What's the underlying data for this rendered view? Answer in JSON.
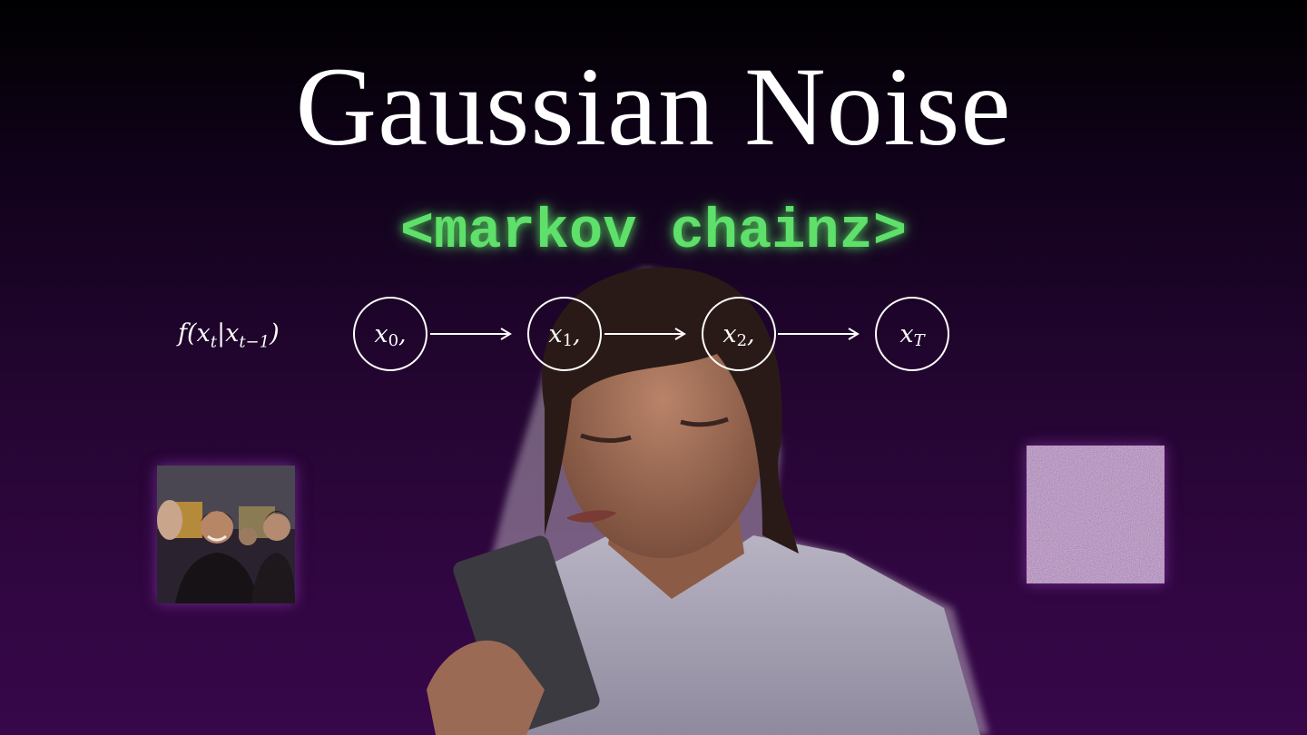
{
  "title": "Gaussian Noise",
  "subtitle": "<markov chainz>",
  "formula": {
    "f": "f",
    "open": "(x",
    "sub1": "t",
    "bar": "|x",
    "sub2": "t−1",
    "close": ")"
  },
  "nodes": [
    {
      "var": "x",
      "sub": "0",
      "suffix": ","
    },
    {
      "var": "x",
      "sub": "1",
      "suffix": ","
    },
    {
      "var": "x",
      "sub": "2",
      "suffix": ","
    },
    {
      "var": "x",
      "sub": "T",
      "suffix": ""
    }
  ],
  "colors": {
    "accent_green": "#5ee06a",
    "background_top": "#000000",
    "background_bottom": "#37074a"
  }
}
